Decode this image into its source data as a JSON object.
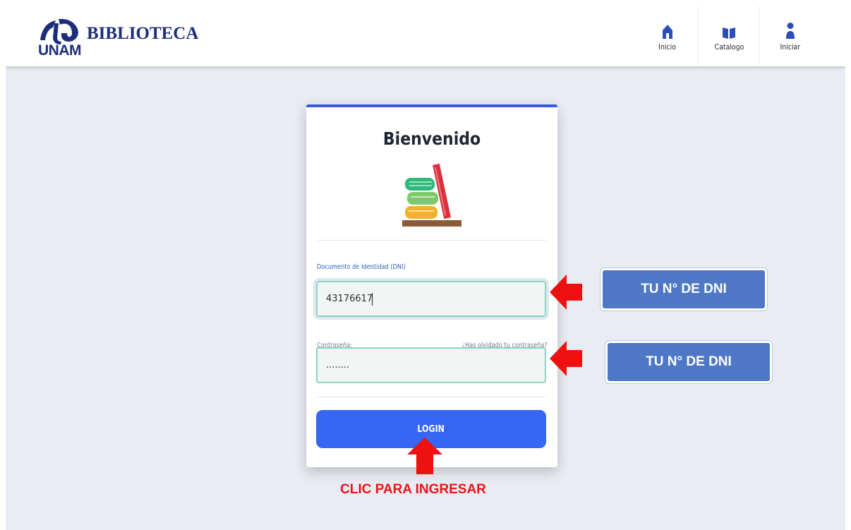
{
  "header": {
    "logo_text": "UNAM",
    "brand_name": "BIBLIOTECA",
    "nav": [
      {
        "label": "Inicio",
        "icon": "home-icon"
      },
      {
        "label": "Catalogo",
        "icon": "book-icon"
      },
      {
        "label": "Iniciar",
        "icon": "user-icon"
      }
    ],
    "brand_color": "#1c2e7a",
    "icon_color": "#2b4db8"
  },
  "login_card": {
    "title": "Bienvenido",
    "illustration": "books-illustration",
    "dni_label": "Documento de Identidad (DNI)",
    "dni_value": "43176617",
    "password_label": "Contraseña:",
    "forgot_link": "¿Has olvidado tu contraseña?",
    "password_value": "........",
    "login_button": "LOGIN",
    "accent_color": "#3557e6",
    "button_color": "#3765f4"
  },
  "annotations": {
    "dni_callout": "TU N° DE DNI",
    "password_callout": "TU N° DE DNI",
    "login_caption": "CLIC PARA INGRESAR",
    "arrow_color": "#ee1111",
    "callout_color": "#4e78c6"
  }
}
